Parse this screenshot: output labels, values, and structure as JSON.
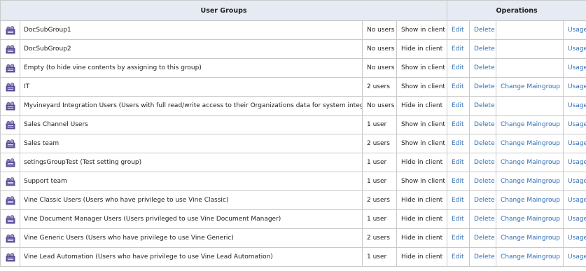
{
  "header": {
    "groups_title": "User Groups",
    "operations_title": "Operations"
  },
  "icon": "user-group-icon",
  "colors": {
    "link": "#2f6db5",
    "header_bg": "#e5eaf3",
    "border": "#c9c9c9"
  },
  "rows": [
    {
      "name": "DocSubGroup1",
      "users": "No users",
      "visibility": "Show in client",
      "edit": "Edit",
      "delete": "Delete",
      "maingroup": "",
      "usage": "Usage"
    },
    {
      "name": "DocSubGroup2",
      "users": "No users",
      "visibility": "Hide in client",
      "edit": "Edit",
      "delete": "Delete",
      "maingroup": "",
      "usage": "Usage"
    },
    {
      "name": "Empty (to hide vine contents by assigning to this group)",
      "users": "No users",
      "visibility": "Show in client",
      "edit": "Edit",
      "delete": "Delete",
      "maingroup": "",
      "usage": "Usage"
    },
    {
      "name": "IT",
      "users": "2 users",
      "visibility": "Show in client",
      "edit": "Edit",
      "delete": "Delete",
      "maingroup": "Change Maingroup",
      "usage": "Usage"
    },
    {
      "name": "Myvineyard Integration Users (Users with full read/write access to their Organizations data for system integrations)",
      "users": "No users",
      "visibility": "Hide in client",
      "edit": "Edit",
      "delete": "Delete",
      "maingroup": "",
      "usage": "Usage"
    },
    {
      "name": "Sales Channel Users",
      "users": "1 user",
      "visibility": "Show in client",
      "edit": "Edit",
      "delete": "Delete",
      "maingroup": "Change Maingroup",
      "usage": "Usage"
    },
    {
      "name": "Sales team",
      "users": "2 users",
      "visibility": "Show in client",
      "edit": "Edit",
      "delete": "Delete",
      "maingroup": "Change Maingroup",
      "usage": "Usage"
    },
    {
      "name": "setingsGroupTest (Test setting group)",
      "users": "1 user",
      "visibility": "Hide in client",
      "edit": "Edit",
      "delete": "Delete",
      "maingroup": "Change Maingroup",
      "usage": "Usage"
    },
    {
      "name": "Support team",
      "users": "1 user",
      "visibility": "Show in client",
      "edit": "Edit",
      "delete": "Delete",
      "maingroup": "Change Maingroup",
      "usage": "Usage"
    },
    {
      "name": "Vine Classic Users (Users who have privilege to use Vine Classic)",
      "users": "2 users",
      "visibility": "Hide in client",
      "edit": "Edit",
      "delete": "Delete",
      "maingroup": "Change Maingroup",
      "usage": "Usage"
    },
    {
      "name": "Vine Document Manager Users (Users privileged to use Vine Document Manager)",
      "users": "1 user",
      "visibility": "Hide in client",
      "edit": "Edit",
      "delete": "Delete",
      "maingroup": "Change Maingroup",
      "usage": "Usage"
    },
    {
      "name": "Vine Generic Users (Users who have privilege to use Vine Generic)",
      "users": "2 users",
      "visibility": "Hide in client",
      "edit": "Edit",
      "delete": "Delete",
      "maingroup": "Change Maingroup",
      "usage": "Usage"
    },
    {
      "name": "Vine Lead Automation (Users who have privilege to use Vine Lead Automation)",
      "users": "1 user",
      "visibility": "Hide in client",
      "edit": "Edit",
      "delete": "Delete",
      "maingroup": "Change Maingroup",
      "usage": "Usage"
    }
  ]
}
